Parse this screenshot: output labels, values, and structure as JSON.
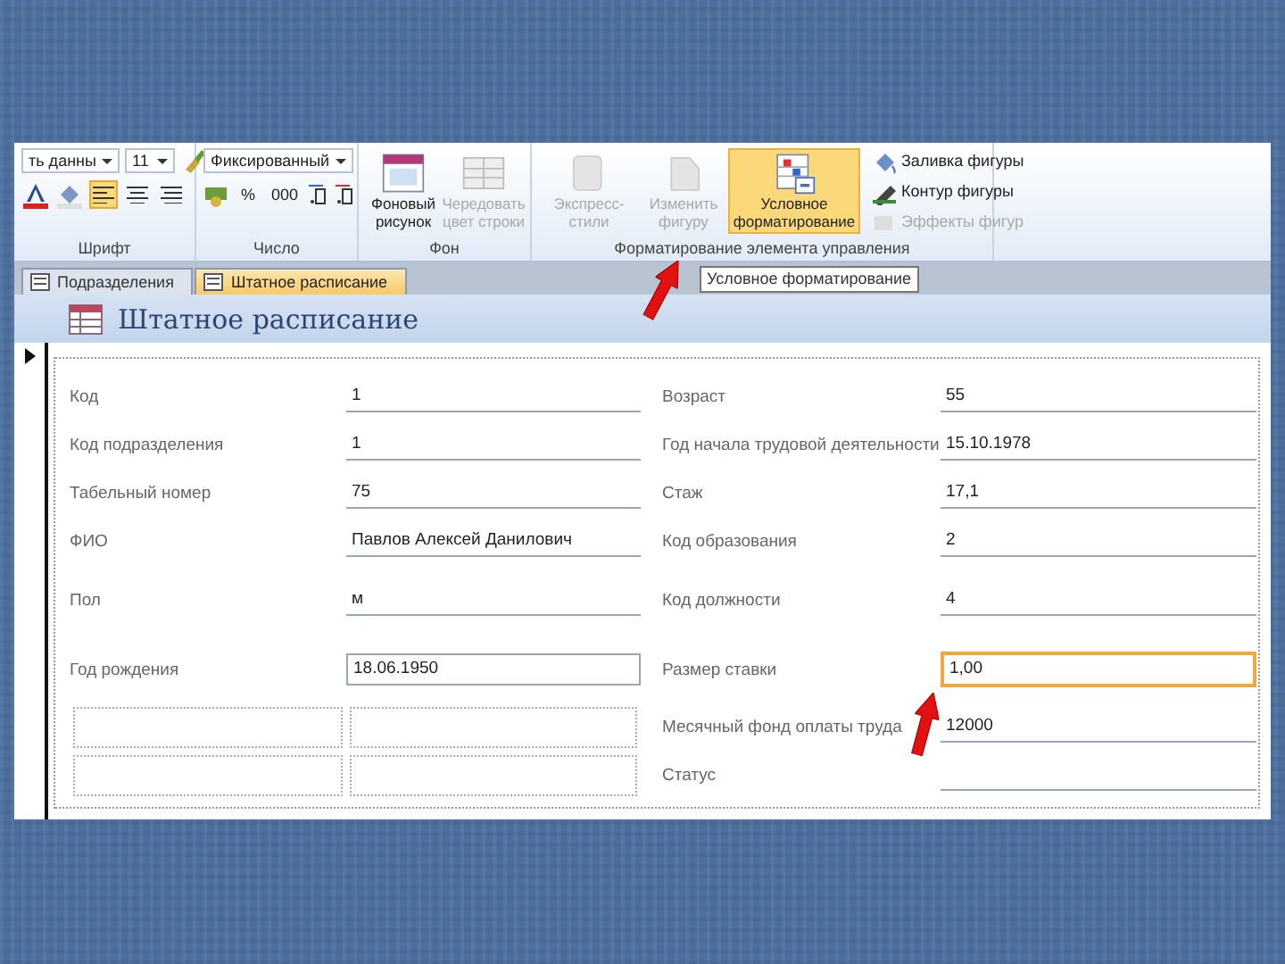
{
  "ribbon": {
    "font_group": {
      "font_name": "ть данны",
      "font_size": "11",
      "label": "Шрифт",
      "alignment": [
        {
          "selected": true
        },
        {
          "selected": false
        },
        {
          "selected": false
        }
      ]
    },
    "number_group": {
      "format": "Фиксированный",
      "percent": "%",
      "thousands": "000",
      "label": "Число"
    },
    "background_group": {
      "label": "Фон",
      "buttons": [
        {
          "label": "Фоновый рисунок",
          "disabled": false,
          "selected": false
        },
        {
          "label": "Чередовать цвет строки",
          "disabled": true,
          "selected": false
        }
      ]
    },
    "control_group": {
      "label": "Форматирование элемента управления",
      "buttons": [
        {
          "label": "Экспресс-стили",
          "disabled": true,
          "selected": false
        },
        {
          "label": "Изменить фигуру",
          "disabled": true,
          "selected": false
        },
        {
          "label": "Условное форматирование",
          "disabled": false,
          "selected": true
        }
      ],
      "small_buttons": [
        {
          "label": "Заливка фигуры",
          "disabled": false
        },
        {
          "label": "Контур фигуры",
          "disabled": false
        },
        {
          "label": "Эффекты фигур",
          "disabled": true
        }
      ]
    }
  },
  "tabs": [
    {
      "label": "Подразделения",
      "selected": false
    },
    {
      "label": "Штатное расписание",
      "selected": true
    }
  ],
  "tooltip": "Условное форматирование",
  "form": {
    "title": "Штатное расписание",
    "fields_left": [
      {
        "label": "Код",
        "value": "1",
        "selected": false,
        "bordered": false
      },
      {
        "label": "Код подразделения",
        "value": "1",
        "selected": false,
        "bordered": false
      },
      {
        "label": "Табельный номер",
        "value": "75",
        "selected": false,
        "bordered": false
      },
      {
        "label": "ФИО",
        "value": "Павлов Алексей Данилович",
        "selected": false,
        "bordered": false
      },
      {
        "label": "Пол",
        "value": "м",
        "selected": false,
        "bordered": false
      },
      {
        "label": "Год рождения",
        "value": "18.06.1950",
        "selected": false,
        "bordered": true
      }
    ],
    "fields_right": [
      {
        "label": "Возраст",
        "value": "55",
        "selected": false,
        "bordered": false
      },
      {
        "label": "Год начала трудовой деятельности",
        "value": "15.10.1978",
        "selected": false,
        "bordered": false
      },
      {
        "label": "Стаж",
        "value": "17,1",
        "selected": false,
        "bordered": false
      },
      {
        "label": "Код образования",
        "value": "2",
        "selected": false,
        "bordered": false
      },
      {
        "label": "Код должности",
        "value": "4",
        "selected": false,
        "bordered": false
      },
      {
        "label": "Размер ставки",
        "value": "1,00",
        "selected": true,
        "bordered": false
      },
      {
        "label": "Месячный фонд оплаты труда",
        "value": "12000",
        "selected": false,
        "bordered": false
      },
      {
        "label": "Статус",
        "selected": false,
        "bordered": false
      }
    ]
  }
}
